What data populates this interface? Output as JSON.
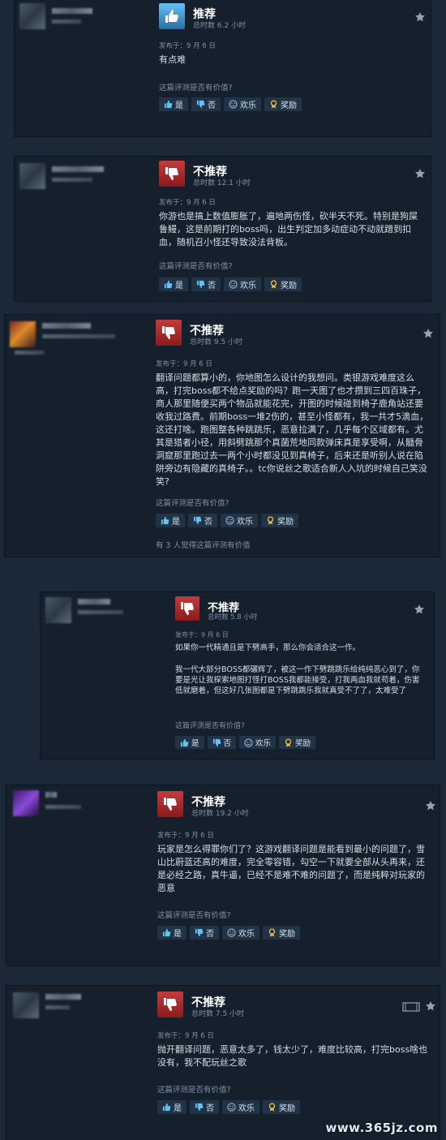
{
  "helpful_question": "这篇评测是否有价值?",
  "buttons": {
    "yes": "是",
    "no": "否",
    "funny": "欢乐",
    "award": "奖励"
  },
  "watermark": "www.365jz.com",
  "colors": {
    "background": "#1b2838",
    "card": "#16202d",
    "recommended": "#66c0f4",
    "not_recommended": "#c33b3b"
  },
  "reviews": [
    {
      "verdict": "推荐",
      "icon": "thumbs-up-icon",
      "hours": "总时数 6.2 小时",
      "date": "发布于：9 月 6 日",
      "text": "有点难"
    },
    {
      "verdict": "不推荐",
      "icon": "thumbs-down-icon",
      "hours": "总时数 12.1 小时",
      "date": "发布于：9 月 6 日",
      "text": "你游也是搞上数值膨胀了，遍地两伤怪，砍半天不死。特别是狗屎鲁鳗，这是前期打的boss吗，出生判定加多动症动不动就蹭到扣血，随机召小怪还导致没法背板。"
    },
    {
      "verdict": "不推荐",
      "icon": "thumbs-down-icon",
      "hours": "总时数 9.5 小时",
      "date": "发布于：9 月 6 日",
      "text": "翻译问题都算小的，你地图怎么设计的我想问。类银游戏难度这么高，打完boss都不给点奖励的吗？跑一天图了也才攒到三四百珠子，商人那里随便买两个物品就能花完，开图的时候碰到椅子鹿角站还要收我过路费。前期boss一堆2伤的，甚至小怪都有，我一共才5滴血，这还打啥。跑图整各种跳跳乐，恶意拉满了，几乎每个区域都有。尤其是猎者小径，用斜劈跳那个真菌荒地同款弹床真是享受啊，从髓骨洞窟那里跑过去一两个小时都没见到真椅子，后来还是听别人说在陷阱旁边有隐藏的真椅子。。tc你说丝之歌适合新人入坑的时候自己笑没笑?",
      "found_helpful": "有 3 人觉得这篇评测有价值"
    },
    {
      "verdict": "不推荐",
      "icon": "thumbs-down-icon",
      "hours": "总时数 5.8 小时",
      "date": "发布于：9 月 6 日",
      "text": "如果你一代精通且是下劈高手，那么你会适合这一作。",
      "text2": "我一代大部分BOSS都碾辉了，被这一作下劈跳跳乐给纯纯恶心到了，你要是光让我探索地图打怪打BOSS我都能接受，打我两血我就苟着，伤害低就磨着，但这好几张图都是下劈跳跳乐我就真受不了了，太难受了"
    },
    {
      "verdict": "不推荐",
      "icon": "thumbs-down-icon",
      "hours": "总时数 19.2 小时",
      "date": "发布于：9 月 6 日",
      "text": "玩家是怎么得罪你们了？这游戏翻译问题是能看到最小的问题了，雪山比蔚蓝还高的难度，完全零容错，勾空一下就要全部从头再来，还是必经之路，真牛逼，已经不是难不难的问题了，而是纯粹对玩家的恶意"
    },
    {
      "verdict": "不推荐",
      "icon": "thumbs-down-icon",
      "hours": "总时数 7.5 小时",
      "date": "发布于：9 月 6 日",
      "text": "抛开翻译问题，恶意太多了，钱太少了，难度比较高，打完boss啥也没有，我不配玩丝之歌"
    }
  ]
}
